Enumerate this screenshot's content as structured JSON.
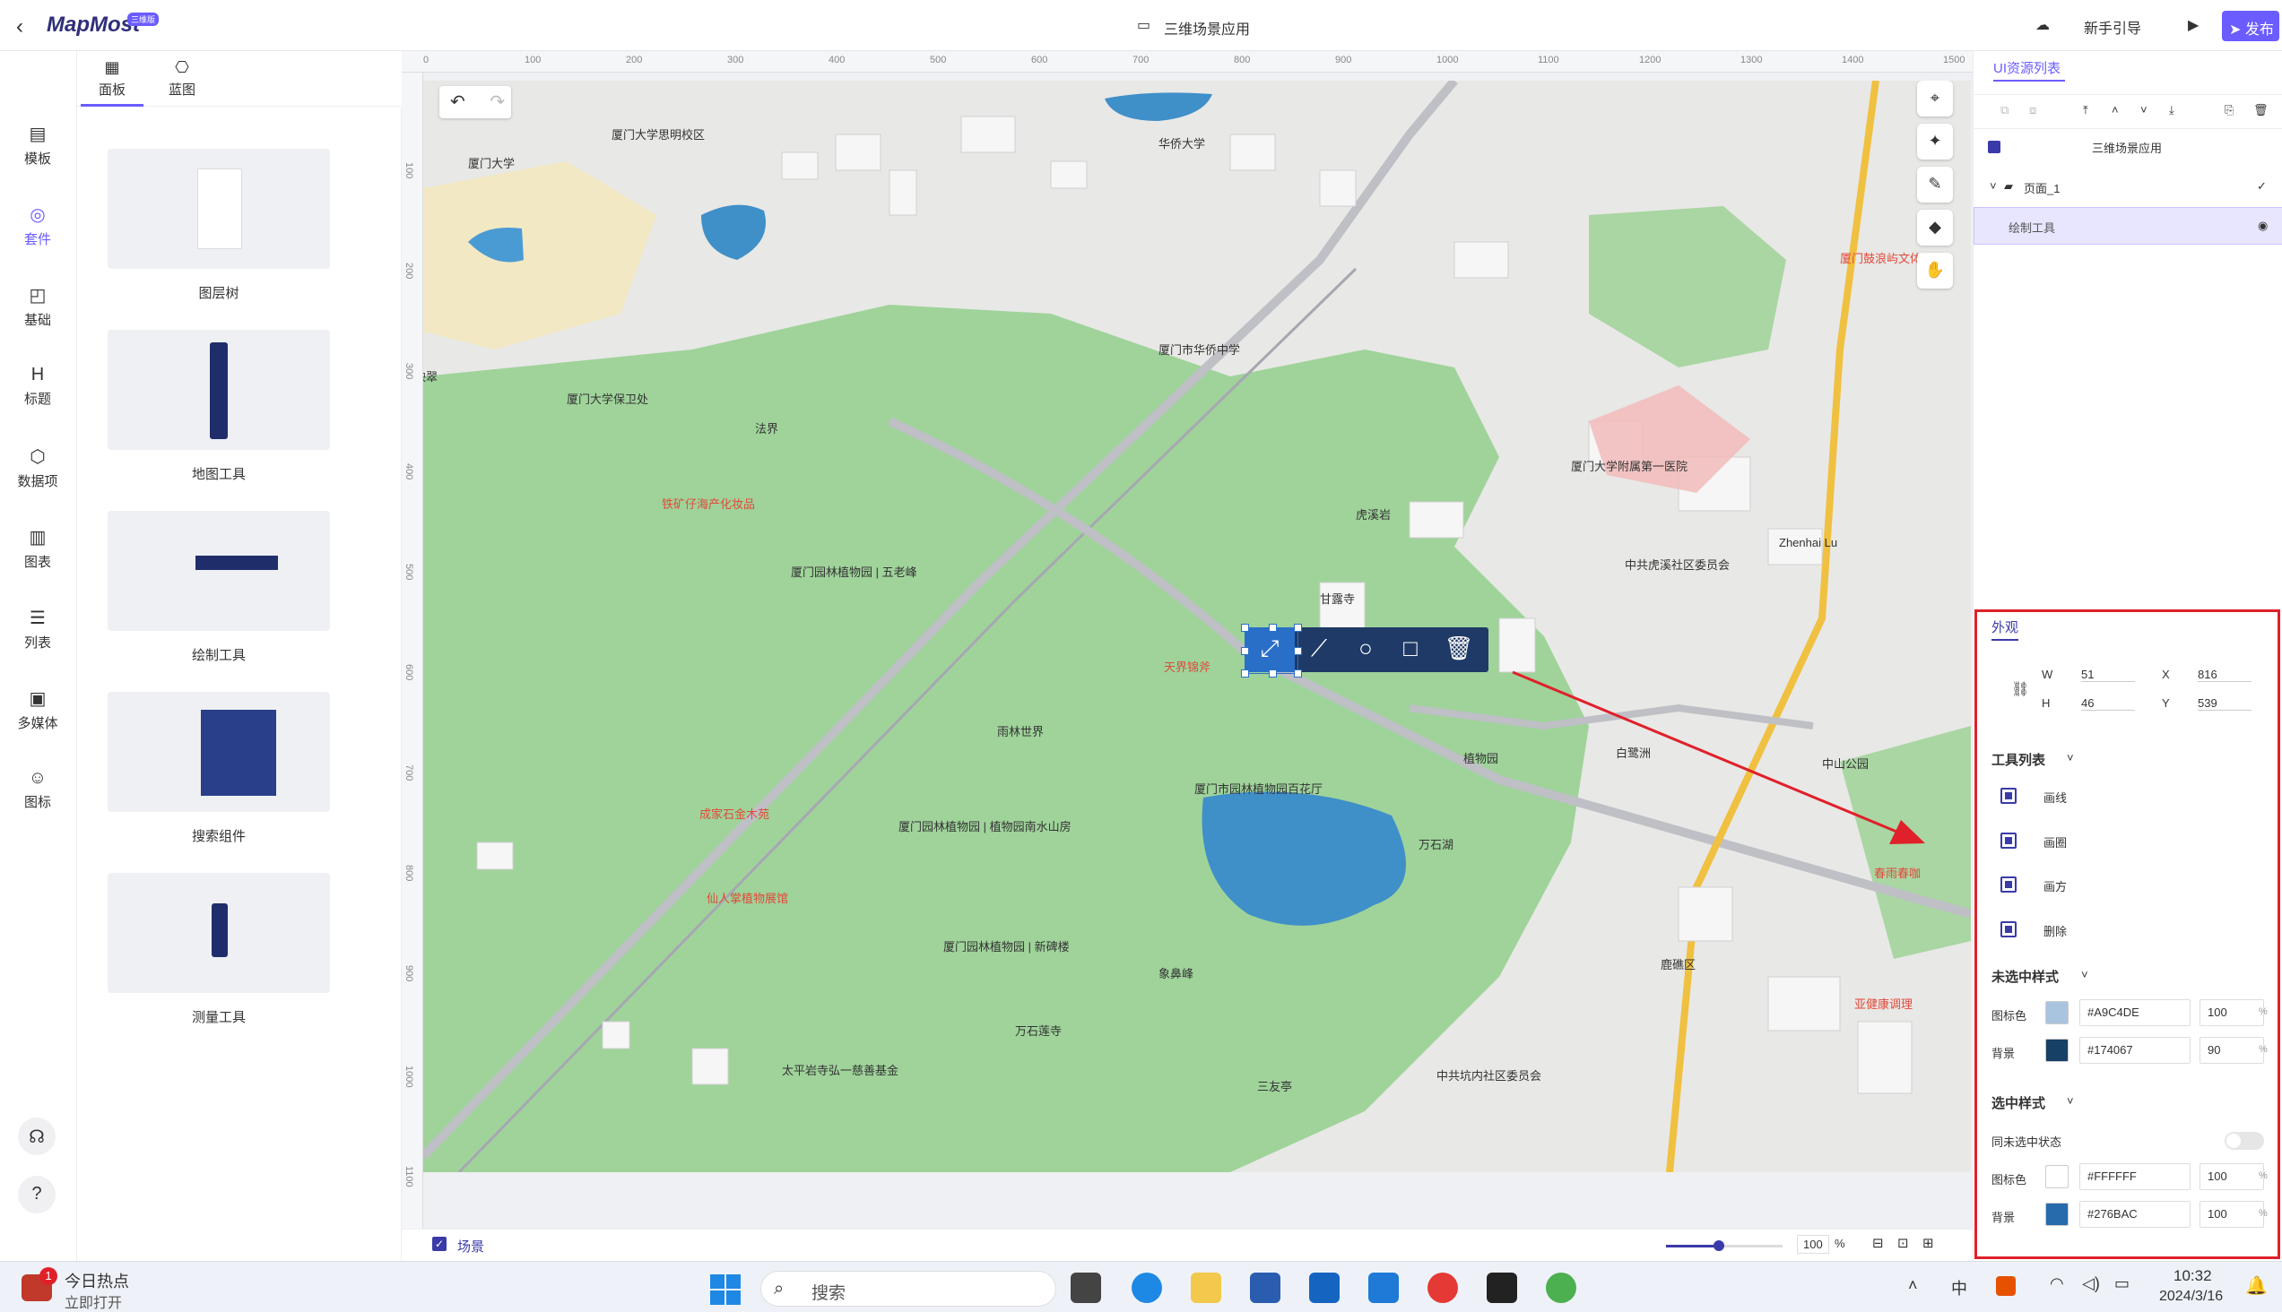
{
  "header": {
    "logo_text": "MapMost",
    "logo_badge": "三维版",
    "app_title": "三维场景应用",
    "guide_label": "新手引导",
    "publish_label": "发布"
  },
  "top_tabs": [
    {
      "label": "场景",
      "icon": "scene-icon"
    },
    {
      "label": "面板",
      "icon": "panel-icon"
    },
    {
      "label": "蓝图",
      "icon": "blueprint-icon"
    }
  ],
  "left_nav": [
    {
      "label": "模板",
      "icon": "template-icon"
    },
    {
      "label": "套件",
      "icon": "kit-icon"
    },
    {
      "label": "基础",
      "icon": "basic-icon"
    },
    {
      "label": "标题",
      "icon": "heading-icon"
    },
    {
      "label": "数据项",
      "icon": "data-item-icon"
    },
    {
      "label": "图表",
      "icon": "chart-icon"
    },
    {
      "label": "列表",
      "icon": "list-icon"
    },
    {
      "label": "多媒体",
      "icon": "media-icon"
    },
    {
      "label": "图标",
      "icon": "emoji-icon"
    }
  ],
  "components": [
    {
      "label": "图层树"
    },
    {
      "label": "地图工具"
    },
    {
      "label": "绘制工具"
    },
    {
      "label": "搜索组件"
    },
    {
      "label": "测量工具"
    }
  ],
  "ruler": {
    "top_ticks": [
      "0",
      "100",
      "200",
      "300",
      "400",
      "500",
      "600",
      "700",
      "800",
      "900",
      "1000",
      "1100",
      "1200",
      "1300",
      "1400",
      "1500"
    ],
    "left_ticks": [
      "100",
      "200",
      "300",
      "400",
      "500",
      "600",
      "700",
      "800",
      "900",
      "1000",
      "1100"
    ]
  },
  "map": {
    "labels": [
      "厦门大学",
      "厦门大学思明校区",
      "华侨大学",
      "厦门市华侨中学",
      "厦门大学附属第一医院",
      "中共虎溪社区委员会",
      "厦门园林植物园 | 五老峰",
      "雨林世界",
      "厦门市园林植物园百花厅",
      "厦门园林植物园 | 植物园南水山房",
      "厦门园林植物园 | 新碑楼",
      "万石莲寺",
      "太平岩寺弘一慈善基金",
      "象鼻峰",
      "三友亭",
      "万石湖",
      "中共坑内社区委员会",
      "厦门大学保卫处",
      "法界",
      "映翠",
      "甘露寺",
      "虎溪岩",
      "中山公园",
      "Zhenhai Lu",
      "植物园",
      "白鹭洲",
      "鹿礁区"
    ],
    "pois": [
      "铁矿仔海产化妆品",
      "天界锦斧",
      "成家石金木苑",
      "仙人掌植物展馆",
      "春雨春咖",
      "亚健康调理",
      "厦门鼓浪屿文体"
    ]
  },
  "draw_toolbar": {
    "tools": [
      {
        "name": "draw-line-icon"
      },
      {
        "name": "draw-polyline-icon"
      },
      {
        "name": "draw-circle-icon"
      },
      {
        "name": "draw-rect-icon"
      },
      {
        "name": "delete-icon"
      }
    ]
  },
  "bottom": {
    "scene_label": "场景",
    "zoom_value": "100",
    "zoom_unit": "%",
    "zoom_level": 0.45
  },
  "right_panel": {
    "title": "UI资源列表",
    "tree": [
      {
        "label": "三维场景应用"
      },
      {
        "label": "页面_1"
      },
      {
        "label": "绘制工具"
      }
    ],
    "appearance_tab": "外观",
    "geometry": {
      "w_label": "W",
      "w": "51",
      "h_label": "H",
      "h": "46",
      "x_label": "X",
      "x": "816",
      "y_label": "Y",
      "y": "539"
    },
    "tool_list_title": "工具列表",
    "tools": [
      "画线",
      "画圈",
      "画方",
      "删除"
    ],
    "unselected_title": "未选中样式",
    "unselected": [
      {
        "label": "图标色",
        "color": "#A9C4DE",
        "opacity": "100",
        "unit": "%"
      },
      {
        "label": "背景",
        "color": "#174067",
        "opacity": "90",
        "unit": "%"
      }
    ],
    "selected_title": "选中样式",
    "sync_label": "同未选中状态",
    "selected": [
      {
        "label": "图标色",
        "color": "#FFFFFF",
        "opacity": "100",
        "unit": "%"
      },
      {
        "label": "背景",
        "color": "#276BAC",
        "opacity": "100",
        "unit": "%"
      }
    ]
  },
  "taskbar": {
    "news_title": "今日热点",
    "news_sub": "立即打开",
    "badge": "1",
    "search_placeholder": "搜索",
    "ime": "中",
    "time": "10:32",
    "date": "2024/3/16"
  },
  "colors": {
    "accent": "#6b5cff",
    "map_green": "#9fd39a",
    "water": "#3f8fc9",
    "highlight_frame": "#e0202a"
  }
}
